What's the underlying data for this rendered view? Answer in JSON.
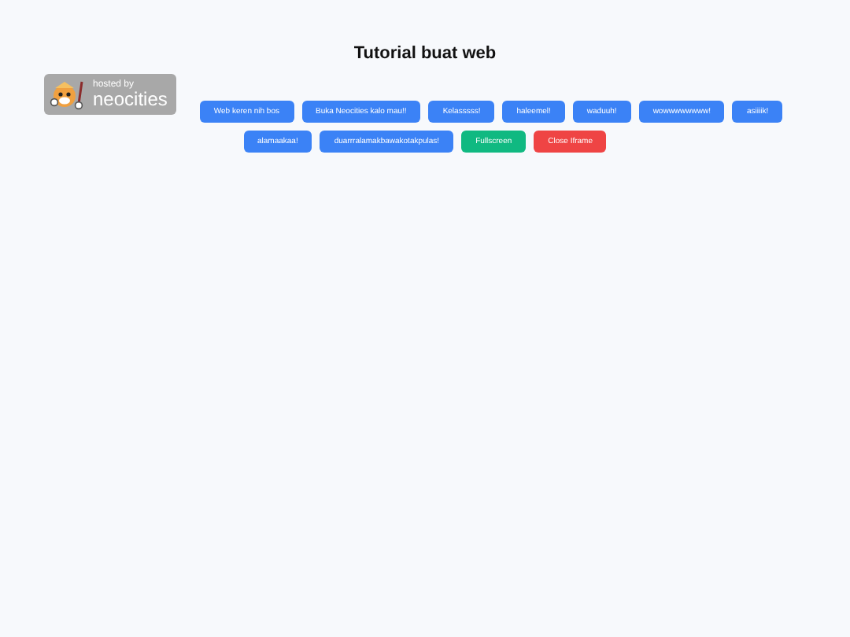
{
  "title": "Tutorial buat web",
  "badge": {
    "line_1": "hosted by",
    "line_2": "neocities"
  },
  "buttons": [
    {
      "label": "Web keren nih bos",
      "kind": "primary"
    },
    {
      "label": "Buka Neocities kalo mau!!",
      "kind": "primary"
    },
    {
      "label": "Kelasssss!",
      "kind": "primary"
    },
    {
      "label": "haleemel!",
      "kind": "primary"
    },
    {
      "label": "waduuh!",
      "kind": "primary"
    },
    {
      "label": "wowwwwwwww!",
      "kind": "primary"
    },
    {
      "label": "asiiiik!",
      "kind": "primary"
    },
    {
      "label": "alamaakaa!",
      "kind": "primary"
    },
    {
      "label": "duarrralamakbawakotakpulas!",
      "kind": "primary"
    },
    {
      "label": "Fullscreen",
      "kind": "success"
    },
    {
      "label": "Close Iframe",
      "kind": "danger"
    }
  ]
}
